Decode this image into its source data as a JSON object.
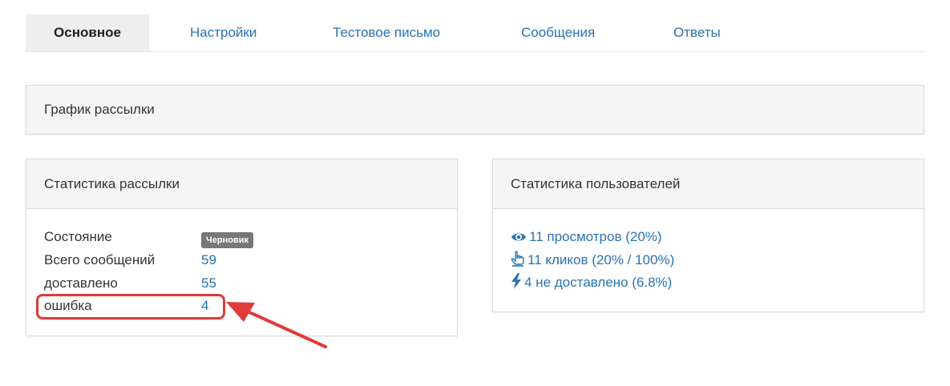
{
  "tabs": [
    {
      "label": "Основное",
      "active": true
    },
    {
      "label": "Настройки",
      "active": false
    },
    {
      "label": "Тестовое письмо",
      "active": false
    },
    {
      "label": "Сообщения",
      "active": false
    },
    {
      "label": "Ответы",
      "active": false
    }
  ],
  "schedule_panel": {
    "title": "График рассылки"
  },
  "mailing_stats": {
    "title": "Статистика рассылки",
    "rows": [
      {
        "label": "Состояние",
        "value": "Черновик"
      },
      {
        "label": "Всего сообщений",
        "value": "59"
      },
      {
        "label": "доставлено",
        "value": "55"
      },
      {
        "label": "ошибка",
        "value": "4"
      }
    ]
  },
  "user_stats": {
    "title": "Статистика пользователей",
    "items": [
      {
        "icon": "eye-icon",
        "text": "11 просмотров (20%)"
      },
      {
        "icon": "pointer-hand-icon",
        "text": "11 кликов (20% / 100%)"
      },
      {
        "icon": "bolt-icon",
        "text": "4 не доставлено (6.8%)"
      }
    ]
  },
  "colors": {
    "link": "#2a72b5",
    "highlight": "#e03a3a",
    "badge": "#777777"
  }
}
